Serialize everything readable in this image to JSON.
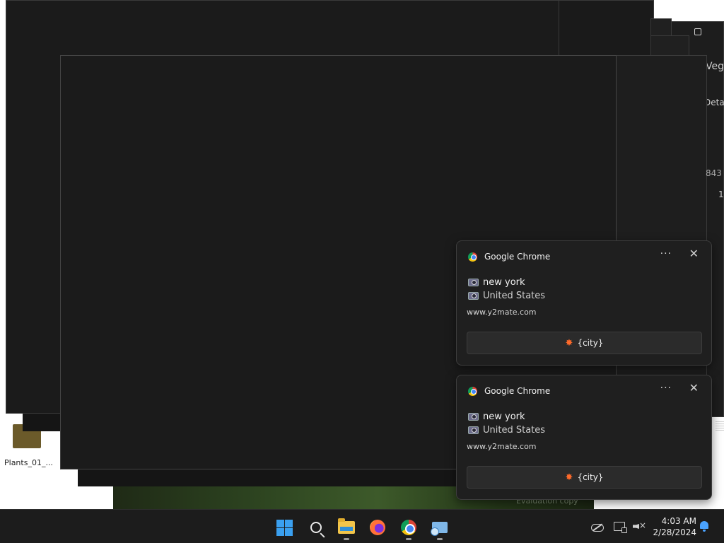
{
  "desktop": {
    "icon_label": "Plants_01_...",
    "watermark": "Evaluation copy"
  },
  "background_window": {
    "partial_texts": [
      "Vega",
      "Detail",
      "843",
      "1"
    ]
  },
  "notifications": [
    {
      "app_name": "Google Chrome",
      "more_label": "···",
      "close_label": "✕",
      "line1": "new york",
      "line2": "United States",
      "url": "www.y2mate.com",
      "action_label": "{city}"
    },
    {
      "app_name": "Google Chrome",
      "more_label": "···",
      "close_label": "✕",
      "line1": "new york",
      "line2": "United States",
      "url": "www.y2mate.com",
      "action_label": "{city}"
    }
  ],
  "taskbar": {
    "apps": [
      "start-icon",
      "search-icon",
      "file-explorer-icon",
      "firefox-icon",
      "chrome-icon",
      "remote-desktop-icon"
    ],
    "clock_time": "4:03 AM",
    "clock_date": "2/28/2024"
  },
  "colors": {
    "accent": "#3aa0f0",
    "notification_bg": "#1f1f1f",
    "taskbar_bg": "#1c1c1c"
  }
}
